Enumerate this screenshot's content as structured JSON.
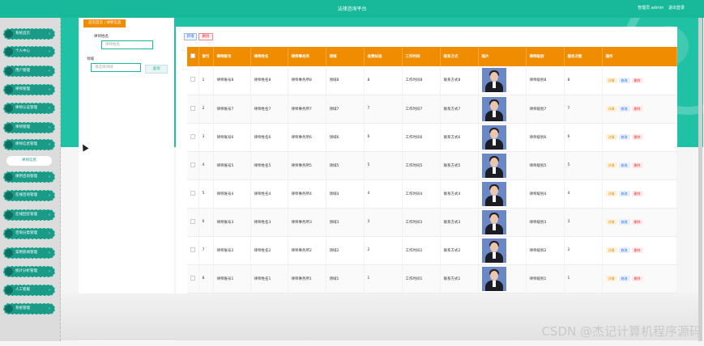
{
  "topbar": {
    "title": "法律咨询平台",
    "user_label": "管理员 admin",
    "logout_label": "退出登录"
  },
  "breadcrumb": {
    "home": "首页首页",
    "separator": "|",
    "current": "律师信息"
  },
  "sidebar": {
    "items": [
      {
        "label": "系统首页"
      },
      {
        "label": "个人中心"
      },
      {
        "label": "用户管理"
      },
      {
        "label": "律师管理"
      },
      {
        "label": "律师认证管理"
      },
      {
        "label": "律师管理"
      },
      {
        "label": "律师信息管理"
      },
      {
        "label": "律所咨询管理"
      },
      {
        "label": "在线咨询管理"
      },
      {
        "label": "在线回答管理"
      },
      {
        "label": "咨询分类管理"
      },
      {
        "label": "案例新闻管理"
      },
      {
        "label": "统计分析管理"
      },
      {
        "label": "人工客服"
      },
      {
        "label": "系统管理"
      }
    ],
    "active_submenu": "律师信息"
  },
  "search": {
    "field1_label": "律师姓名",
    "field1_placeholder": "律师姓名",
    "field2_label": "领域",
    "field2_placeholder": "请选择领域",
    "button_label": "查询"
  },
  "actions": {
    "add_label": "新增",
    "delete_label": "删除"
  },
  "table": {
    "headers": [
      "",
      "索引",
      "律师账号",
      "律师姓名",
      "律师事务所",
      "领域",
      "收费标准",
      "工作时间",
      "联系方式",
      "照片",
      "律师级别",
      "服务次数",
      "操作"
    ],
    "rows": [
      {
        "idx": "1",
        "account": "律师账号8",
        "name": "律师姓名8",
        "firm": "律师事务所8",
        "field": "领域8",
        "fee": "8",
        "time": "工作时间8",
        "contact": "联系方式8",
        "level": "律师级别8",
        "count": "8"
      },
      {
        "idx": "2",
        "account": "律师账号7",
        "name": "律师姓名7",
        "firm": "律师事务所7",
        "field": "领域7",
        "fee": "7",
        "time": "工作时间7",
        "contact": "联系方式7",
        "level": "律师级别7",
        "count": "7"
      },
      {
        "idx": "3",
        "account": "律师账号6",
        "name": "律师姓名6",
        "firm": "律师事务所6",
        "field": "领域6",
        "fee": "6",
        "time": "工作时间6",
        "contact": "联系方式6",
        "level": "律师级别6",
        "count": "6"
      },
      {
        "idx": "4",
        "account": "律师账号5",
        "name": "律师姓名5",
        "firm": "律师事务所5",
        "field": "领域5",
        "fee": "5",
        "time": "工作时间5",
        "contact": "联系方式5",
        "level": "律师级别5",
        "count": "5"
      },
      {
        "idx": "5",
        "account": "律师账号4",
        "name": "律师姓名4",
        "firm": "律师事务所4",
        "field": "领域4",
        "fee": "4",
        "time": "工作时间4",
        "contact": "联系方式4",
        "level": "律师级别4",
        "count": "4"
      },
      {
        "idx": "6",
        "account": "律师账号3",
        "name": "律师姓名3",
        "firm": "律师事务所3",
        "field": "领域3",
        "fee": "3",
        "time": "工作时间3",
        "contact": "联系方式3",
        "level": "律师级别3",
        "count": "3"
      },
      {
        "idx": "7",
        "account": "律师账号2",
        "name": "律师姓名2",
        "firm": "律师事务所2",
        "field": "领域2",
        "fee": "2",
        "time": "工作时间2",
        "contact": "联系方式2",
        "level": "律师级别2",
        "count": "2"
      },
      {
        "idx": "8",
        "account": "律师账号1",
        "name": "律师姓名1",
        "firm": "律师事务所1",
        "field": "领域1",
        "fee": "1",
        "time": "工作时间1",
        "contact": "联系方式1",
        "level": "律师级别1",
        "count": "1"
      }
    ],
    "row_actions": {
      "detail": "详情",
      "edit": "修改",
      "delete": "删除"
    }
  },
  "watermark": "CSDN @杰记计算机程序源码",
  "colors": {
    "primary": "#18b89a",
    "accent": "#f08c00"
  }
}
